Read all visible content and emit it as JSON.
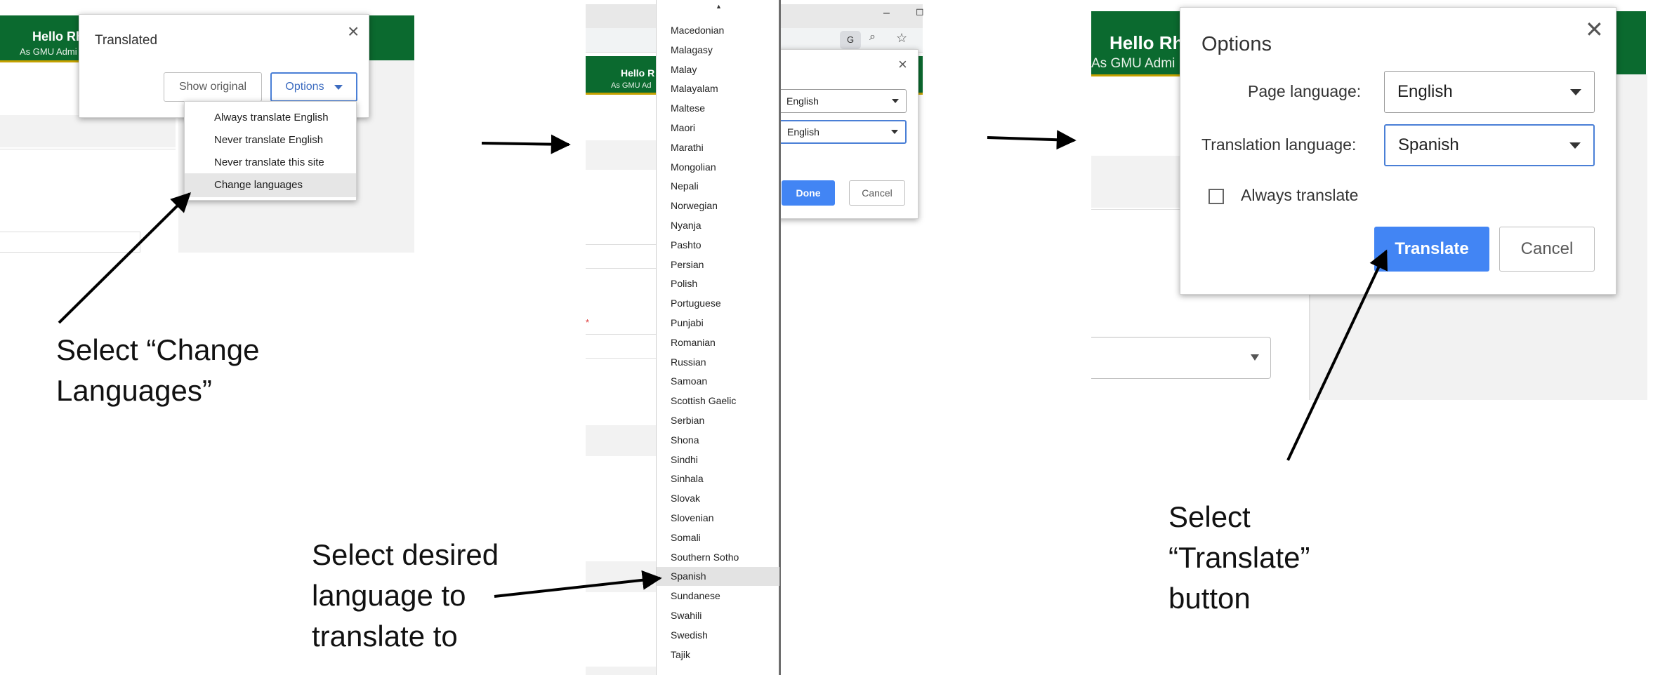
{
  "panel1": {
    "header_hello": "Hello Rh",
    "header_sub": "As GMU Admi",
    "popup": {
      "title": "Translated",
      "close": "×",
      "show_original": "Show original",
      "options": "Options"
    },
    "menu": [
      "Always translate English",
      "Never translate English",
      "Never translate this site",
      "Change languages"
    ],
    "highlighted_index": 3
  },
  "panel2": {
    "header_hello": "Hello R",
    "header_sub": "As GMU Ad",
    "close": "×",
    "page_language": "English",
    "translation_language": "English",
    "done": "Done",
    "cancel": "Cancel",
    "languages": [
      "Macedonian",
      "Malagasy",
      "Malay",
      "Malayalam",
      "Maltese",
      "Maori",
      "Marathi",
      "Mongolian",
      "Nepali",
      "Norwegian",
      "Nyanja",
      "Pashto",
      "Persian",
      "Polish",
      "Portuguese",
      "Punjabi",
      "Romanian",
      "Russian",
      "Samoan",
      "Scottish Gaelic",
      "Serbian",
      "Shona",
      "Sindhi",
      "Sinhala",
      "Slovak",
      "Slovenian",
      "Somali",
      "Southern Sotho",
      "Spanish",
      "Sundanese",
      "Swahili",
      "Swedish",
      "Tajik"
    ],
    "highlighted_language": "Spanish",
    "asterisk": "*"
  },
  "panel3": {
    "header_hello": "Hello Rh",
    "header_sub": "As GMU Admi",
    "title": "Options",
    "close": "✕",
    "page_language_label": "Page language:",
    "page_language_value": "English",
    "translation_language_label": "Translation language:",
    "translation_language_value": "Spanish",
    "always_translate": "Always translate",
    "translate": "Translate",
    "cancel": "Cancel"
  },
  "captions": {
    "step1_line1": "Select “Change",
    "step1_line2": "Languages”",
    "step2_line1": "Select desired",
    "step2_line2": "language to",
    "step2_line3": "translate to",
    "step3_line1": "Select",
    "step3_line2": "“Translate”",
    "step3_line3": "button"
  },
  "colors": {
    "header_green": "#0b6a2f",
    "header_gold": "#c5a100",
    "accent_blue": "#4285f4"
  }
}
